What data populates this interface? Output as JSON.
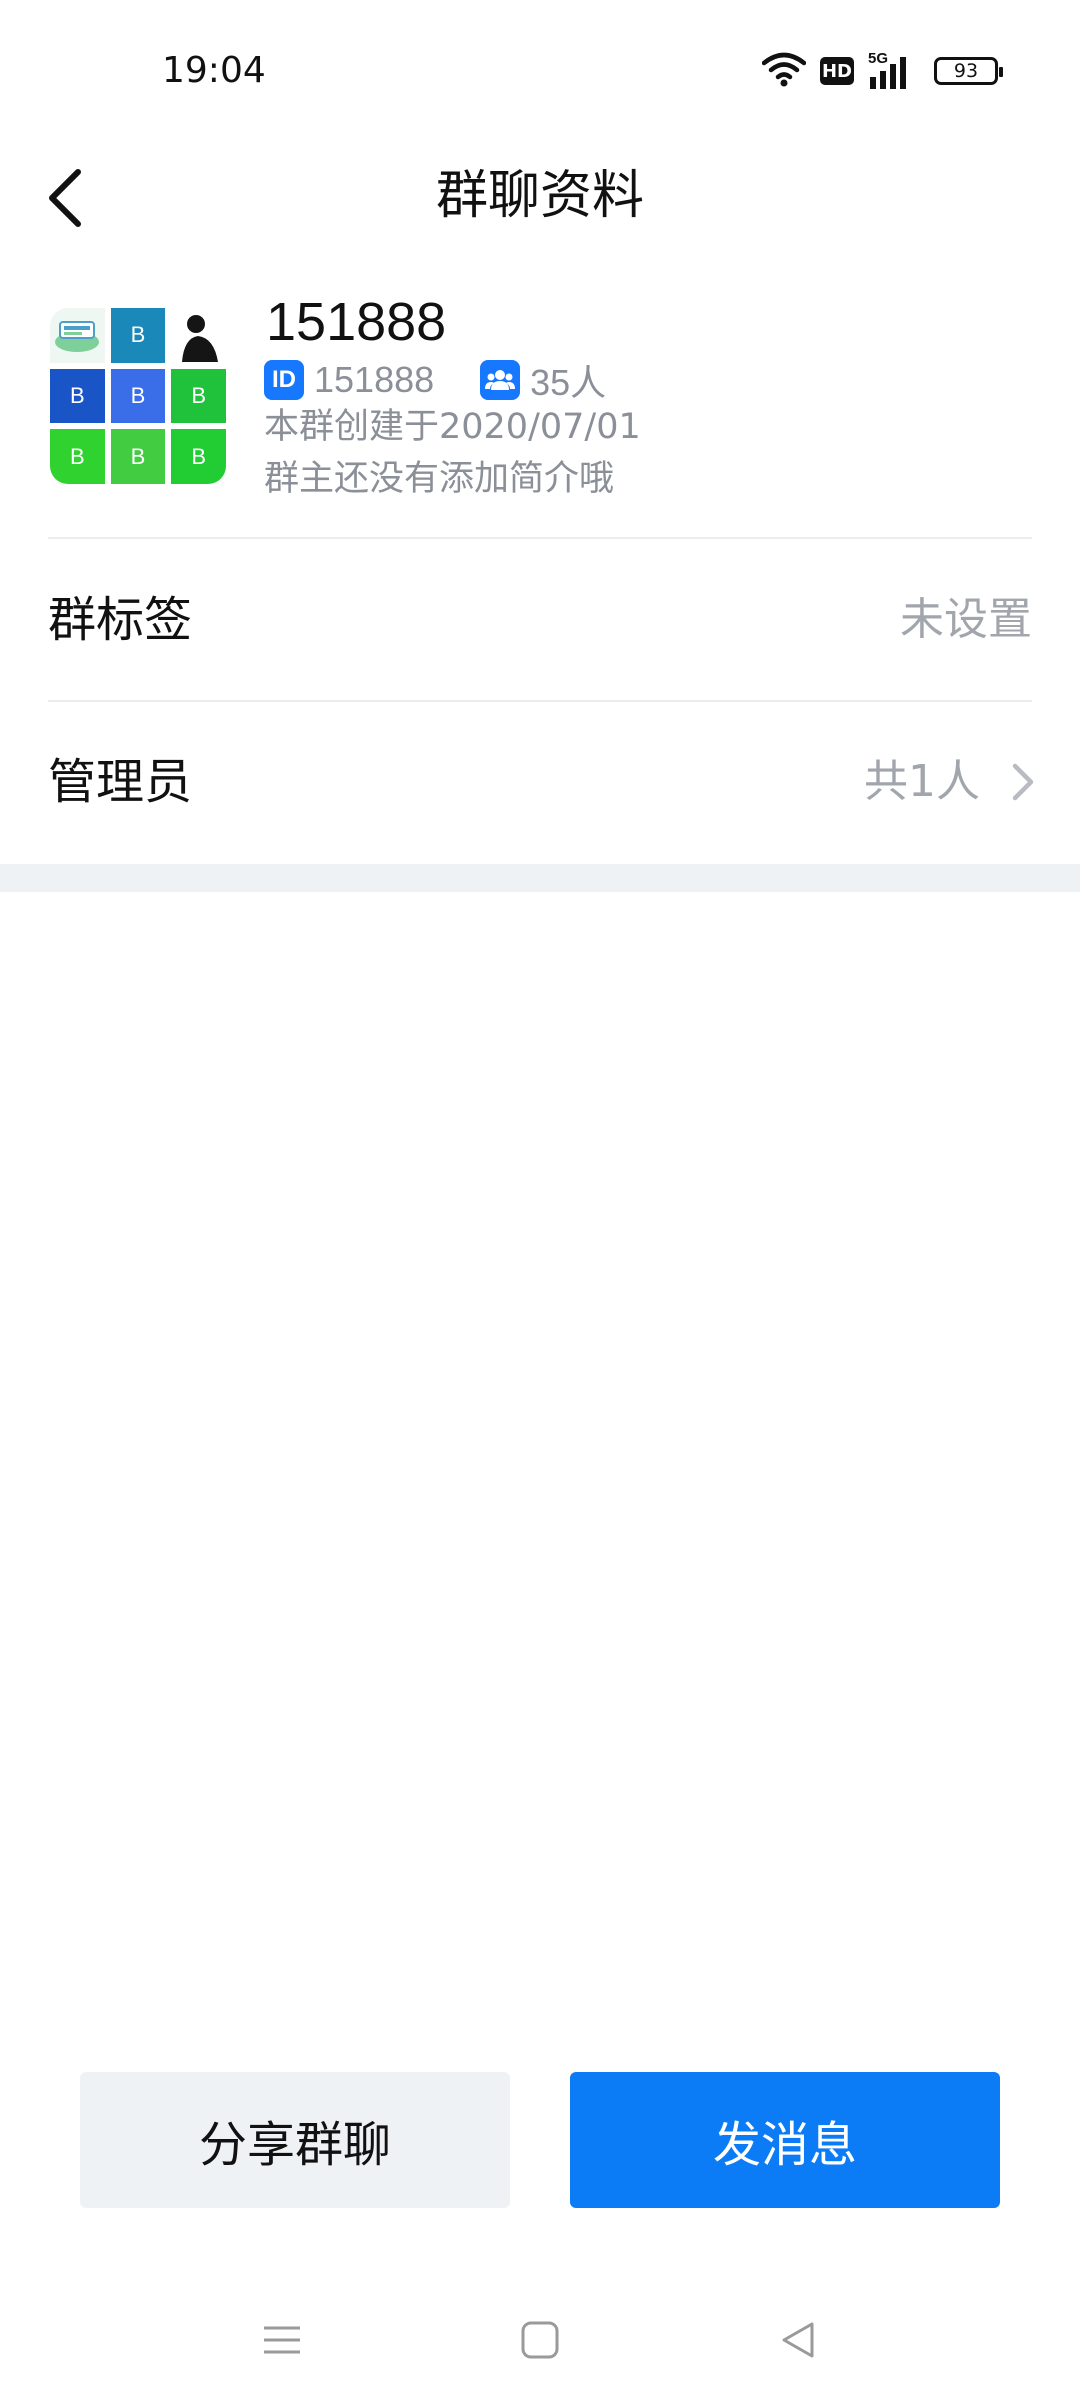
{
  "status_bar": {
    "time": "19:04",
    "network": "5G",
    "hd": "HD",
    "battery": "93"
  },
  "header": {
    "title": "群聊资料"
  },
  "group": {
    "name": "151888",
    "id_badge": "ID",
    "id": "151888",
    "member_count": "35人",
    "created": "本群创建于2020/07/01",
    "intro": "群主还没有添加简介哦",
    "avatar_cells": [
      {
        "label": "",
        "color": "#f0f7f3"
      },
      {
        "label": "B",
        "color": "#1a88b8"
      },
      {
        "label": "",
        "color": "#ffffff"
      },
      {
        "label": "B",
        "color": "#1a55c8"
      },
      {
        "label": "B",
        "color": "#3a6ee8"
      },
      {
        "label": "B",
        "color": "#1fc23a"
      },
      {
        "label": "B",
        "color": "#2fd22f"
      },
      {
        "label": "B",
        "color": "#42cc42"
      },
      {
        "label": "B",
        "color": "#22cc33"
      }
    ]
  },
  "rows": {
    "tag": {
      "label": "群标签",
      "value": "未设置"
    },
    "admin": {
      "label": "管理员",
      "value": "共1人"
    }
  },
  "buttons": {
    "share": "分享群聊",
    "send": "发消息"
  },
  "colors": {
    "accent": "#0c7cf6",
    "badge_blue": "#1677ff",
    "muted_text": "#8a8f98",
    "secondary_bg": "#eff2f5"
  },
  "icons": {
    "back": "chevron-left-icon",
    "members": "people-icon",
    "wifi": "wifi-icon",
    "signal": "signal-icon",
    "chevron": "chevron-right-icon",
    "menu": "menu-icon",
    "home": "home-icon",
    "back_nav": "back-triangle-icon"
  }
}
